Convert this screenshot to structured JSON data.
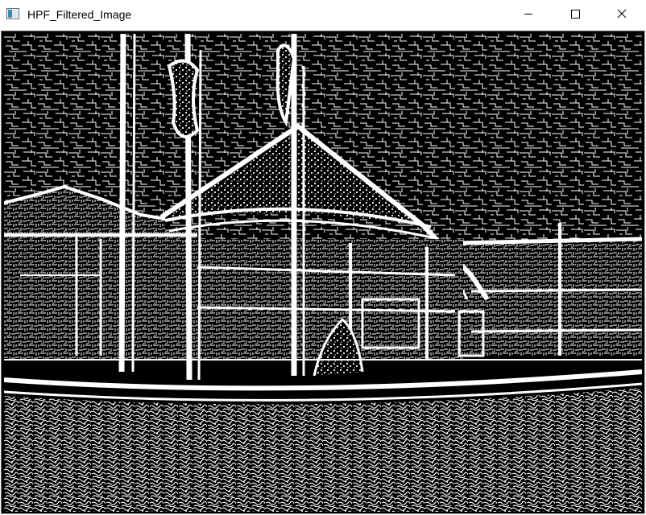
{
  "window": {
    "title": "HPF_Filtered_Image",
    "buttons": {
      "minimize_icon": "minimize-icon",
      "maximize_icon": "maximize-icon",
      "close_icon": "close-icon"
    }
  },
  "image": {
    "description_icon": "edge-filtered-image",
    "colors": {
      "background": "#000000",
      "edges": "#ffffff"
    }
  }
}
